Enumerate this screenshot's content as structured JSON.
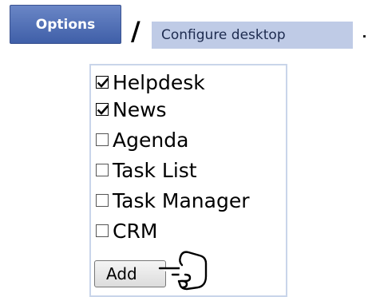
{
  "header": {
    "options_label": "Options",
    "separator": "/",
    "breadcrumb_label": "Configure desktop"
  },
  "panel": {
    "items": [
      {
        "label": "Helpdesk",
        "checked": true
      },
      {
        "label": "News",
        "checked": true
      },
      {
        "label": "Agenda",
        "checked": false
      },
      {
        "label": "Task List",
        "checked": false
      },
      {
        "label": "Task Manager",
        "checked": false
      },
      {
        "label": "CRM",
        "checked": false
      }
    ],
    "add_label": "Add"
  },
  "icons": {
    "pointer": "hand-pointer-icon",
    "check": "checkmark-icon"
  },
  "colors": {
    "options_button": "#4a68b0",
    "breadcrumb_bg": "#bfcbe6",
    "panel_border": "#c9d5ea"
  }
}
